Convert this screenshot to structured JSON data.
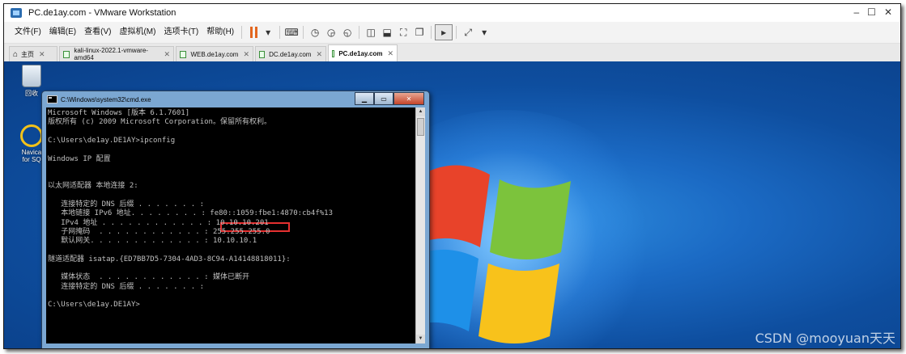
{
  "window": {
    "title": "PC.de1ay.com - VMware Workstation",
    "controls": [
      "–",
      "☐",
      "✕"
    ]
  },
  "menu": [
    "文件(F)",
    "编辑(E)",
    "查看(V)",
    "虚拟机(M)",
    "选项卡(T)",
    "帮助(H)"
  ],
  "tabs": [
    {
      "label": "主页",
      "active": false
    },
    {
      "label": "kali-linux-2022.1-vmware-amd64",
      "active": false
    },
    {
      "label": "WEB.de1ay.com",
      "active": false
    },
    {
      "label": "DC.de1ay.com",
      "active": false
    },
    {
      "label": "PC.de1ay.com",
      "active": true
    }
  ],
  "desktop_icons": {
    "recycle_bin": "回收",
    "navicat_line1": "Navica",
    "navicat_line2": "for SQ"
  },
  "cmd": {
    "title": "C:\\Windows\\system32\\cmd.exe",
    "lines": [
      "Microsoft Windows [版本 6.1.7601]",
      "版权所有 (c) 2009 Microsoft Corporation。保留所有权利。",
      "",
      "C:\\Users\\de1ay.DE1AY>ipconfig",
      "",
      "Windows IP 配置",
      "",
      "",
      "以太网适配器 本地连接 2:",
      "",
      "   连接特定的 DNS 后缀 . . . . . . . :",
      "   本地链接 IPv6 地址. . . . . . . . : fe80::1059:fbe1:4870:cb4f%13",
      "   IPv4 地址 . . . . . . . . . . . . : 10.10.10.201",
      "   子网掩码  . . . . . . . . . . . . : 255.255.255.0",
      "   默认网关. . . . . . . . . . . . . : 10.10.10.1",
      "",
      "隧道适配器 isatap.{ED7BB7D5-7304-4AD3-8C94-A14148818011}:",
      "",
      "   媒体状态  . . . . . . . . . . . . : 媒体已断开",
      "   连接特定的 DNS 后缀 . . . . . . . :",
      "",
      "C:\\Users\\de1ay.DE1AY>"
    ]
  },
  "watermark": "CSDN @mooyuan天天",
  "colors": {
    "desktop": "#1b6ac4",
    "console_bg": "#000000",
    "console_text": "#c0c0c0",
    "highlight": "#e53030"
  }
}
